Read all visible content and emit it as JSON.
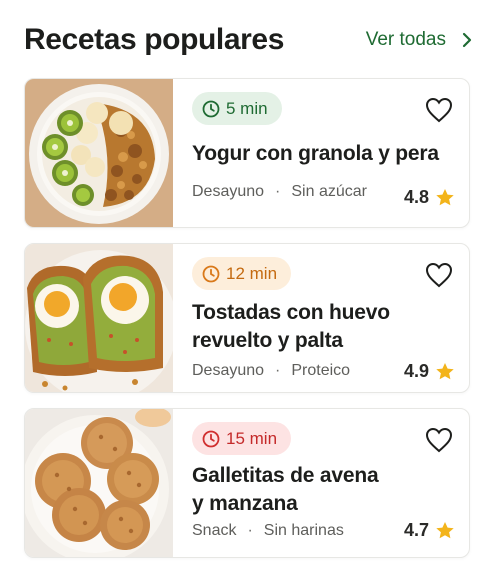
{
  "header": {
    "title": "Recetas populares",
    "see_all_label": "Ver todas"
  },
  "colors": {
    "accent_green": "#1f6b33",
    "star": "#f3b41b",
    "badge_green_bg": "#e4f1e6",
    "badge_orange_bg": "#fdeedb",
    "badge_red_bg": "#fde3e3"
  },
  "recipes": [
    {
      "time": "5 min",
      "time_color": "green",
      "title_line1": "Yogur con granola y pera",
      "title_line2": "",
      "category": "Desayuno",
      "tag": "Sin azúcar",
      "rating": "4.8",
      "image": "yogurt-granola-bowl"
    },
    {
      "time": "12 min",
      "time_color": "orange",
      "title_line1": "Tostadas con huevo",
      "title_line2": "revuelto y palta",
      "category": "Desayuno",
      "tag": "Proteico",
      "rating": "4.9",
      "image": "avocado-egg-toast"
    },
    {
      "time": "15 min",
      "time_color": "red",
      "title_line1": "Galletitas de avena",
      "title_line2": "y manzana",
      "category": "Snack",
      "tag": "Sin harinas",
      "rating": "4.7",
      "image": "oat-cookies"
    }
  ],
  "icons": {
    "see_all": "chevron-right-icon",
    "time": "clock-icon",
    "favorite": "heart-outline-icon",
    "rating": "star-icon"
  }
}
